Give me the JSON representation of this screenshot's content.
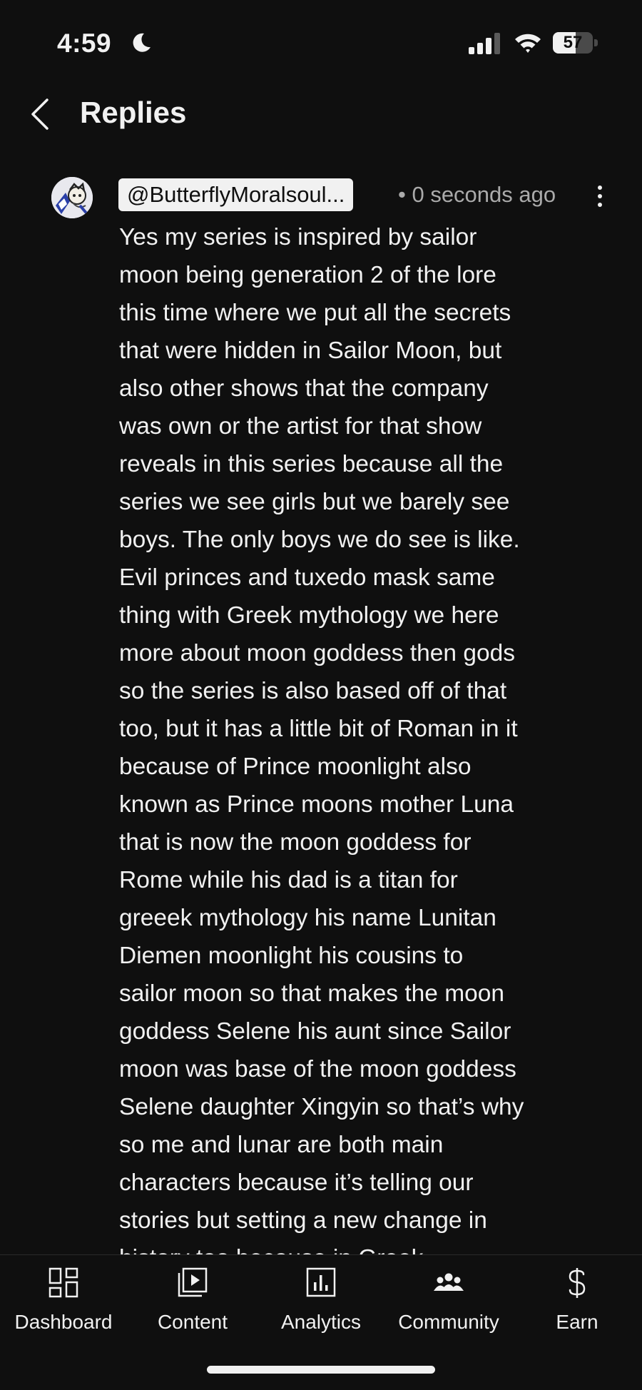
{
  "status_bar": {
    "time": "4:59",
    "battery_percent": "57",
    "battery_level": 0.57
  },
  "header": {
    "title": "Replies"
  },
  "reply": {
    "handle": "@ButterflyMoralsoul...",
    "timestamp": "• 0 seconds ago",
    "text": "Yes my series is inspired by sailor\nmoon being generation 2 of the lore\nthis  time where we put all the secrets\nthat were hidden in Sailor Moon, but\nalso other shows that the company\nwas own or the artist for that show\nreveals in this series because all the\nseries we see girls but we barely see\nboys. The only boys we do see is like.\nEvil princes and tuxedo mask same\nthing with Greek mythology we here\nmore about moon goddess then gods\nso the series is also based off of that\ntoo, but it has a little bit of Roman in it\nbecause of Prince moonlight also\nknown as Prince moons mother Luna\nthat is now the moon goddess for\nRome while his dad is a titan for\ngreeek mythology his name Lunitan\nDiemen moonlight his cousins to\nsailor moon so that makes the moon\ngoddess Selene his aunt since Sailor\nmoon was base of the moon goddess\nSelene daughter Xingyin so that’s why\nso me and lunar are both main\ncharacters because it’s telling our\nstories but setting a new change in\nhistory too because in Greek"
  },
  "bottom_nav": {
    "items": [
      {
        "label": "Dashboard",
        "icon": "dashboard-icon"
      },
      {
        "label": "Content",
        "icon": "content-icon"
      },
      {
        "label": "Analytics",
        "icon": "analytics-icon"
      },
      {
        "label": "Community",
        "icon": "community-icon"
      },
      {
        "label": "Earn",
        "icon": "earn-icon"
      }
    ]
  },
  "colors": {
    "background": "#0f0f0f",
    "text": "#f1f1f1",
    "secondary_text": "#aaaaaa"
  }
}
